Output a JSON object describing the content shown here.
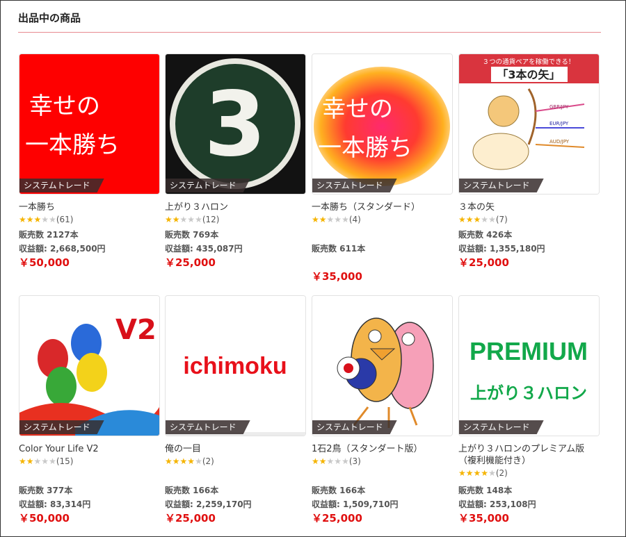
{
  "section_title": "出品中の商品",
  "category_tag": "システムトレード",
  "products": [
    {
      "thumb_text": [
        "幸せの",
        "一本勝ち"
      ],
      "thumb_icon": "red-calligraphy-icon",
      "name": "一本勝ち",
      "stars": 2.5,
      "reviews": "(61)",
      "sold": "販売数 2127本",
      "earnings": "収益額: 2,668,500円",
      "price": "￥50,000"
    },
    {
      "thumb_text": [
        "3"
      ],
      "thumb_icon": "number-three-sign-icon",
      "name": "上がり３ハロン",
      "stars": 1.5,
      "reviews": "(12)",
      "sold": "販売数 769本",
      "earnings": "収益額: 435,087円",
      "price": "￥25,000"
    },
    {
      "thumb_text": [
        "幸せの",
        "一本勝ち"
      ],
      "thumb_icon": "watercolor-calligraphy-icon",
      "name": "一本勝ち（スタンダード）",
      "stars": 1.5,
      "reviews": "(4)",
      "sold": "販売数 611本",
      "earnings": "",
      "price": "￥35,000"
    },
    {
      "thumb_text": [
        "３つの通貨ペアを稼働できる！",
        "「3本の矢」",
        "GBP/JPY",
        "EUR/JPY",
        "AUD/JPY"
      ],
      "thumb_icon": "cupid-archer-icon",
      "name": "３本の矢",
      "stars": 2.5,
      "reviews": "(7)",
      "sold": "販売数 426本",
      "earnings": "収益額: 1,355,180円",
      "price": "￥25,000"
    },
    {
      "thumb_text": [
        "V2"
      ],
      "thumb_icon": "paint-buckets-icon",
      "name": "Color Your Life V2",
      "stars": 2,
      "reviews": "(15)",
      "sold": "販売数 377本",
      "earnings": "収益額: 83,314円",
      "price": "￥50,000"
    },
    {
      "thumb_text": [
        "ichimoku"
      ],
      "thumb_icon": "ichimoku-logo-icon",
      "name": "俺の一目",
      "stars": 3.5,
      "reviews": "(2)",
      "sold": "販売数 166本",
      "earnings": "収益額: 2,259,170円",
      "price": "￥25,000"
    },
    {
      "thumb_text": [],
      "thumb_icon": "two-birds-icon",
      "name": "1石2鳥（スタンダート版）",
      "stars": 2,
      "reviews": "(3)",
      "sold": "販売数 166本",
      "earnings": "収益額: 1,509,710円",
      "price": "￥25,000"
    },
    {
      "thumb_text": [
        "PREMIUM",
        "上がり３ハロン"
      ],
      "thumb_icon": "premium-logo-icon",
      "name": "上がり３ハロンのプレミアム版（複利機能付き）",
      "stars": 4,
      "reviews": "(2)",
      "sold": "販売数 148本",
      "earnings": "収益額: 253,108円",
      "price": "￥35,000"
    }
  ],
  "colors": {
    "price": "#e01010",
    "star": "#f5b400",
    "rule": "#e8898f"
  }
}
